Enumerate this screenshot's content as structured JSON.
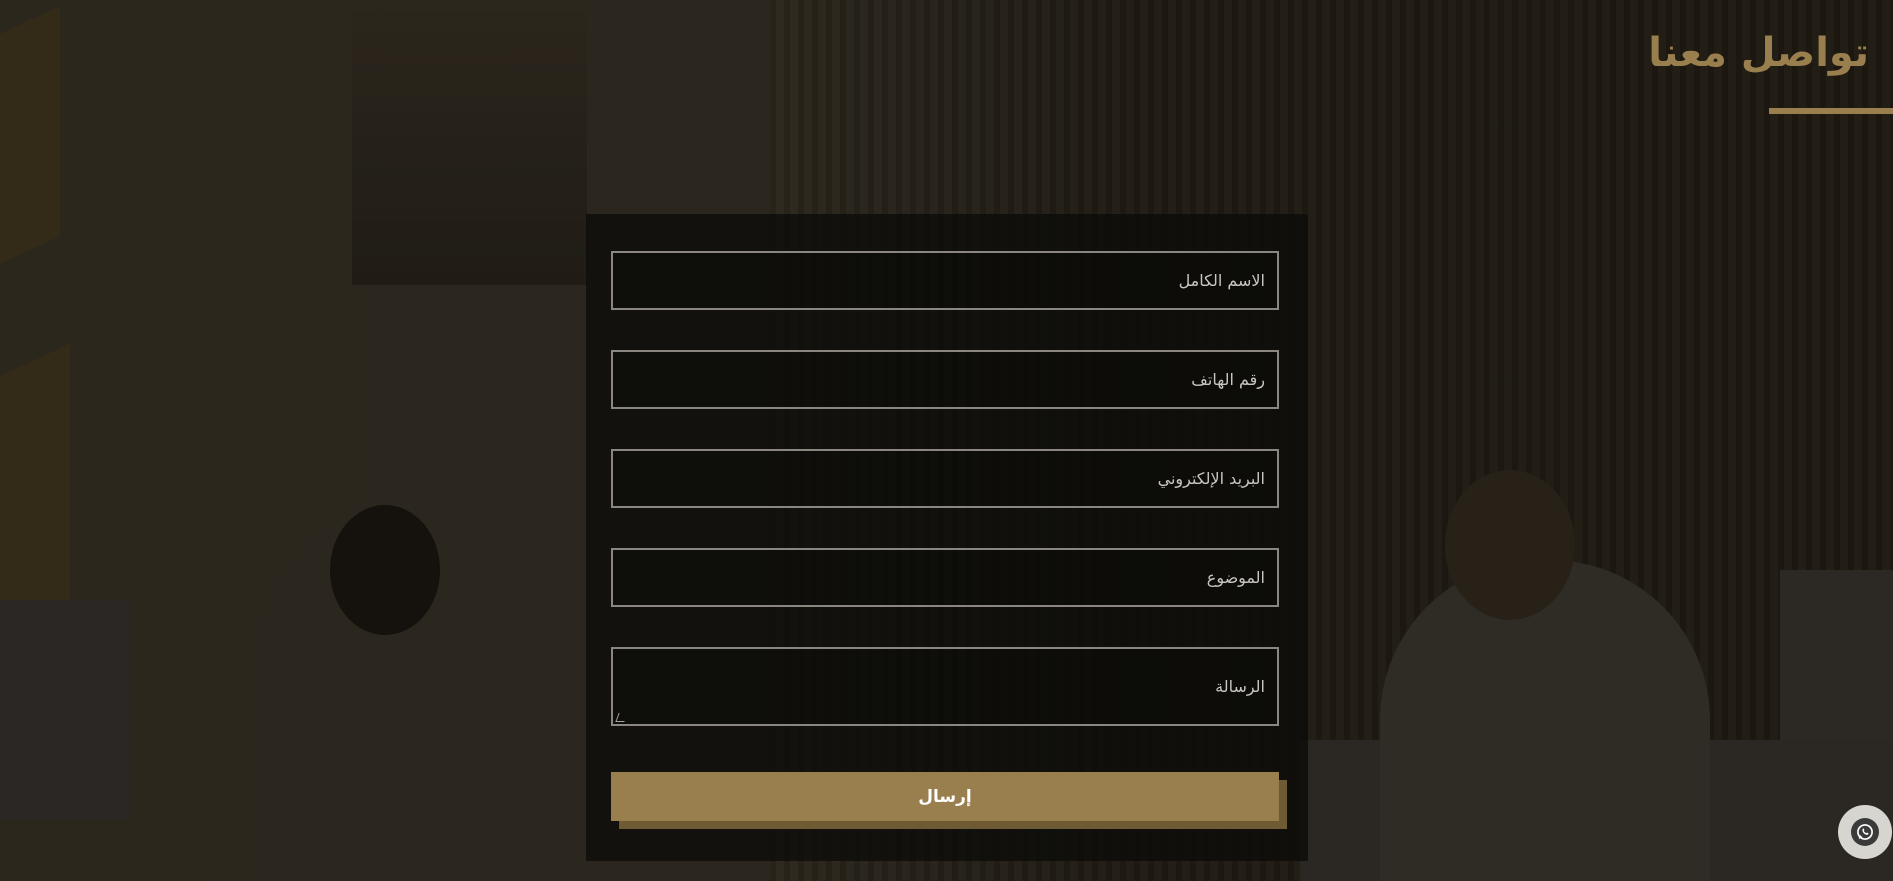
{
  "header": {
    "title": "تواصل معنا"
  },
  "form": {
    "fields": [
      {
        "placeholder": "الاسم الكامل"
      },
      {
        "placeholder": "رقم الهاتف"
      },
      {
        "placeholder": "البريد الإلكتروني"
      },
      {
        "placeholder": "الموضوع"
      },
      {
        "placeholder": "الرسالة"
      }
    ],
    "submit_label": "إرسال"
  },
  "floating": {
    "whatsapp_icon": "whatsapp-icon"
  },
  "colors": {
    "accent": "#9a7f4e",
    "card_bg": "#0c0b09",
    "field_border": "#8b8780"
  }
}
